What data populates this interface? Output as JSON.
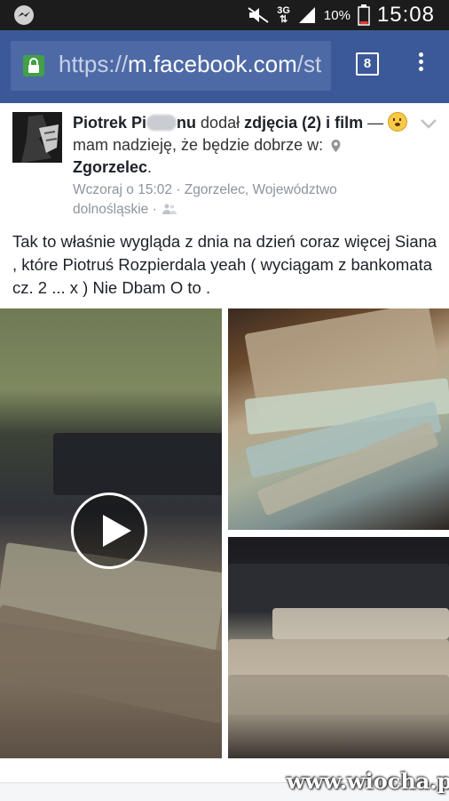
{
  "status_bar": {
    "network": "3G",
    "battery": "10%",
    "time": "15:08"
  },
  "browser": {
    "url_scheme": "https://",
    "url_host": "m.facebook.com",
    "url_rest": "/st",
    "tab_count": "8"
  },
  "post": {
    "author": "Piotrek Pi",
    "author_tail": "nu",
    "action": "dodał",
    "attachments": "zdjęcia (2) i film",
    "dash": "—",
    "feeling": "mam nadzieję, że będzie dobrze w:",
    "place": "Zgorzelec",
    "place_suffix": ".",
    "timestamp": "Wczoraj o 15:02",
    "location": "Zgorzelec, Województwo dolnośląskie",
    "meta_sep": "·",
    "text": "Tak to właśnie wygląda z dnia na dzień coraz więcej Siana , które Piotruś Rozpierdala yeah ( wyciągam z bankomata cz. 2 ... x ) Nie Dbam O to ."
  },
  "watermark": "www.wiocha.pl",
  "colors": {
    "fb_blue": "#3b5998",
    "status_bg": "#1c1c1c",
    "meta_gray": "#8d949e"
  }
}
